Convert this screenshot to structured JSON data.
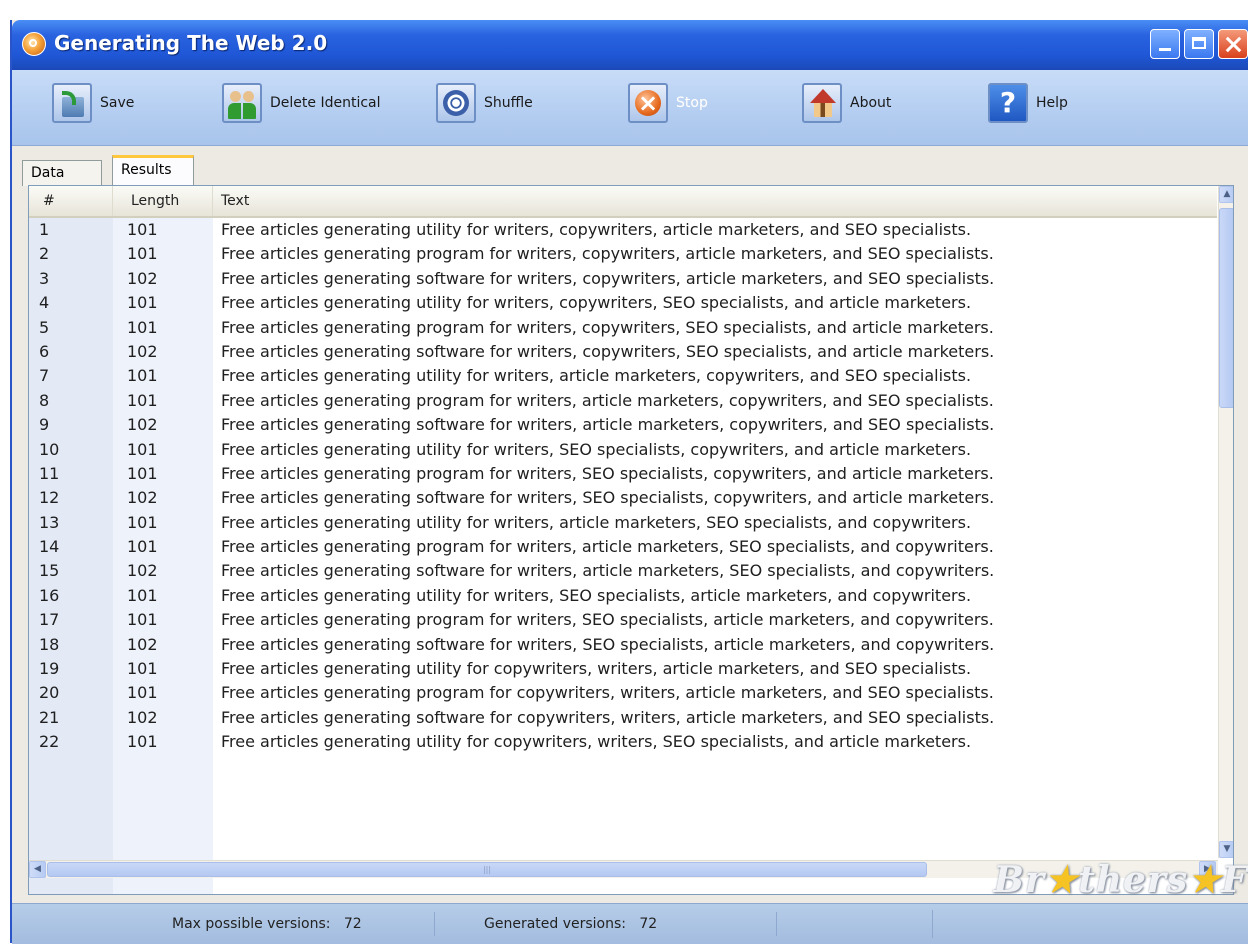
{
  "window": {
    "title": "Generating The Web 2.0"
  },
  "toolbar": {
    "save": "Save",
    "delete_identical": "Delete Identical",
    "shuffle": "Shuffle",
    "stop": "Stop",
    "about": "About",
    "help": "Help"
  },
  "tabs": {
    "data": "Data",
    "results": "Results"
  },
  "table": {
    "columns": {
      "num": "#",
      "length": "Length",
      "text": "Text"
    },
    "rows": [
      {
        "num": "1",
        "length": "101",
        "text": "Free articles generating utility for writers, copywriters, article marketers, and SEO specialists."
      },
      {
        "num": "2",
        "length": "101",
        "text": "Free articles generating program for writers, copywriters, article marketers, and SEO specialists."
      },
      {
        "num": "3",
        "length": "102",
        "text": "Free articles generating software for writers, copywriters, article marketers, and SEO specialists."
      },
      {
        "num": "4",
        "length": "101",
        "text": "Free articles generating utility for writers, copywriters, SEO specialists, and article marketers."
      },
      {
        "num": "5",
        "length": "101",
        "text": "Free articles generating program for writers, copywriters, SEO specialists, and article marketers."
      },
      {
        "num": "6",
        "length": "102",
        "text": "Free articles generating software for writers, copywriters, SEO specialists, and article marketers."
      },
      {
        "num": "7",
        "length": "101",
        "text": "Free articles generating utility for writers, article marketers, copywriters, and SEO specialists."
      },
      {
        "num": "8",
        "length": "101",
        "text": "Free articles generating program for writers, article marketers, copywriters, and SEO specialists."
      },
      {
        "num": "9",
        "length": "102",
        "text": "Free articles generating software for writers, article marketers, copywriters, and SEO specialists."
      },
      {
        "num": "10",
        "length": "101",
        "text": "Free articles generating utility for writers, SEO specialists, copywriters, and article marketers."
      },
      {
        "num": "11",
        "length": "101",
        "text": "Free articles generating program for writers, SEO specialists, copywriters, and article marketers."
      },
      {
        "num": "12",
        "length": "102",
        "text": "Free articles generating software for writers, SEO specialists, copywriters, and article marketers."
      },
      {
        "num": "13",
        "length": "101",
        "text": "Free articles generating utility for writers, article marketers, SEO specialists, and copywriters."
      },
      {
        "num": "14",
        "length": "101",
        "text": "Free articles generating program for writers, article marketers, SEO specialists, and copywriters."
      },
      {
        "num": "15",
        "length": "102",
        "text": "Free articles generating software for writers, article marketers, SEO specialists, and copywriters."
      },
      {
        "num": "16",
        "length": "101",
        "text": "Free articles generating utility for writers, SEO specialists, article marketers, and copywriters."
      },
      {
        "num": "17",
        "length": "101",
        "text": "Free articles generating program for writers, SEO specialists, article marketers, and copywriters."
      },
      {
        "num": "18",
        "length": "102",
        "text": "Free articles generating software for writers, SEO specialists, article marketers, and copywriters."
      },
      {
        "num": "19",
        "length": "101",
        "text": "Free articles generating utility for copywriters, writers, article marketers, and SEO specialists."
      },
      {
        "num": "20",
        "length": "101",
        "text": "Free articles generating program for copywriters, writers, article marketers, and SEO specialists."
      },
      {
        "num": "21",
        "length": "102",
        "text": "Free articles generating software for copywriters, writers, article marketers, and SEO specialists."
      },
      {
        "num": "22",
        "length": "101",
        "text": "Free articles generating utility for copywriters, writers, SEO specialists, and article marketers."
      }
    ]
  },
  "status": {
    "max_label": "Max possible versions:",
    "max_value": "72",
    "generated_label": "Generated versions:",
    "generated_value": "72"
  },
  "watermark": {
    "text_a": "Br",
    "text_b": "thers",
    "text_c": "F"
  },
  "colors": {
    "titlebar": "#2a63e0",
    "toolbar": "#b3cdf1",
    "tab_active_accent": "#ffc83c"
  }
}
